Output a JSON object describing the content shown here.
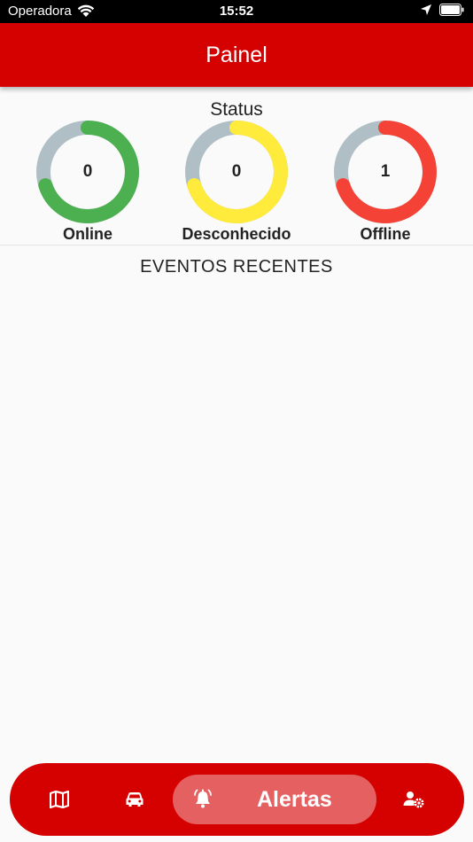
{
  "status_bar": {
    "carrier": "Operadora",
    "time": "15:52"
  },
  "header": {
    "title": "Painel"
  },
  "status": {
    "title": "Status",
    "gauges": [
      {
        "label": "Online",
        "value": "0",
        "color": "#4caf50",
        "fraction": 0.7
      },
      {
        "label": "Desconhecido",
        "value": "0",
        "color": "#ffeb3b",
        "fraction": 0.7
      },
      {
        "label": "Offline",
        "value": "1",
        "color": "#f44336",
        "fraction": 0.7
      }
    ],
    "track_color": "#b0bec5"
  },
  "events": {
    "title": "EVENTOS RECENTES"
  },
  "bottom_nav": {
    "items": [
      {
        "icon": "map-icon"
      },
      {
        "icon": "car-icon"
      },
      {
        "icon": "alarm-bell-icon",
        "label": "Alertas",
        "active": true
      },
      {
        "icon": "user-settings-icon"
      }
    ]
  },
  "colors": {
    "primary": "#d50000"
  }
}
